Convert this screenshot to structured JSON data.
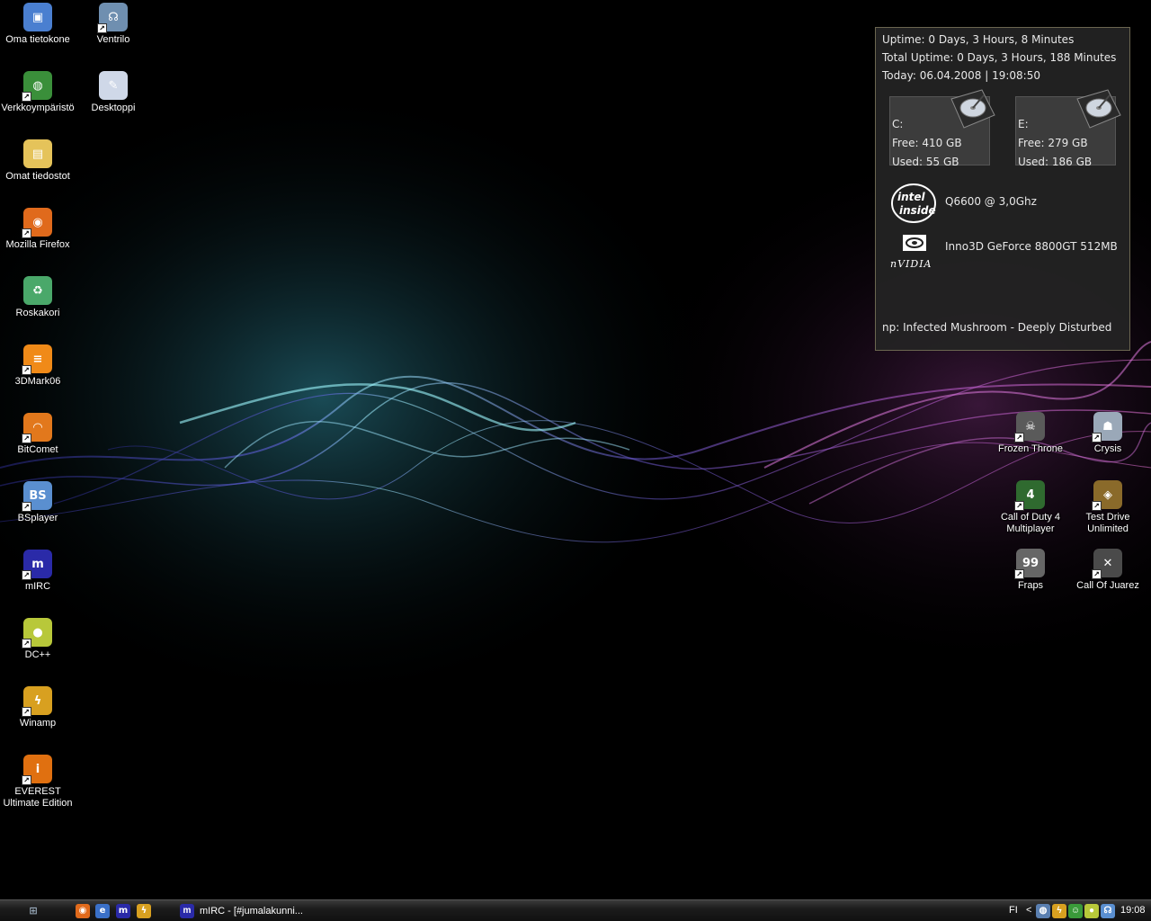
{
  "desktop_left": [
    {
      "label": "Oma tietokone",
      "icon": "my-computer-icon",
      "color": "#4a7fd0",
      "glyph": "▣",
      "shortcut": false
    },
    {
      "label": "Verkkoympäristö",
      "icon": "network-icon",
      "color": "#3a8f3a",
      "glyph": "◍",
      "shortcut": true
    },
    {
      "label": "Omat tiedostot",
      "icon": "my-documents-icon",
      "color": "#e5c35a",
      "glyph": "▤",
      "shortcut": false
    },
    {
      "label": "Mozilla Firefox",
      "icon": "firefox-icon",
      "color": "#e06a1c",
      "glyph": "◉",
      "shortcut": true
    },
    {
      "label": "Roskakori",
      "icon": "recycle-bin-icon",
      "color": "#4aa86a",
      "glyph": "♻",
      "shortcut": false
    },
    {
      "label": "3DMark06",
      "icon": "3dmark-icon",
      "color": "#f08a18",
      "glyph": "≡",
      "shortcut": true
    },
    {
      "label": "BitComet",
      "icon": "bitcomet-icon",
      "color": "#e2781c",
      "glyph": "◠",
      "shortcut": true
    },
    {
      "label": "BSplayer",
      "icon": "bsplayer-icon",
      "color": "#5a8fd0",
      "glyph": "BS",
      "shortcut": true
    },
    {
      "label": "mIRC",
      "icon": "mirc-icon",
      "color": "#2a2aa8",
      "glyph": "m",
      "shortcut": true
    },
    {
      "label": "DC++",
      "icon": "dcpp-icon",
      "color": "#b8c83a",
      "glyph": "●",
      "shortcut": true
    },
    {
      "label": "Winamp",
      "icon": "winamp-icon",
      "color": "#d8a020",
      "glyph": "ϟ",
      "shortcut": true
    },
    {
      "label": "EVEREST Ultimate Edition",
      "icon": "everest-icon",
      "color": "#e07010",
      "glyph": "i",
      "shortcut": true
    }
  ],
  "desktop_col2": [
    {
      "label": "Ventrilo",
      "icon": "ventrilo-icon",
      "color": "#6f8fb0",
      "glyph": "☊",
      "shortcut": true
    },
    {
      "label": "Desktoppi",
      "icon": "desktoppi-icon",
      "color": "#cfd8e8",
      "glyph": "✎",
      "shortcut": false
    }
  ],
  "desktop_right": [
    {
      "label": "Frozen Throne",
      "icon": "frozen-throne-icon",
      "color": "#5a5a5a",
      "glyph": "☠",
      "shortcut": true
    },
    {
      "label": "Crysis",
      "icon": "crysis-icon",
      "color": "#9aa8b8",
      "glyph": "☗",
      "shortcut": true
    },
    {
      "label": "Call of Duty 4 Multiplayer",
      "icon": "cod4-icon",
      "color": "#2f6a2f",
      "glyph": "4",
      "shortcut": true
    },
    {
      "label": "Test Drive Unlimited",
      "icon": "test-drive-icon",
      "color": "#8a6a2a",
      "glyph": "◈",
      "shortcut": true
    },
    {
      "label": "Fraps",
      "icon": "fraps-icon",
      "color": "#666666",
      "glyph": "99",
      "shortcut": true
    },
    {
      "label": "Call Of Juarez",
      "icon": "call-of-juarez-icon",
      "color": "#4a4a4a",
      "glyph": "✕",
      "shortcut": true
    }
  ],
  "widget": {
    "uptime": "Uptime: 0 Days, 3 Hours, 8 Minutes",
    "total_uptime": "Total Uptime: 0 Days, 3 Hours, 188 Minutes",
    "today": "Today: 06.04.2008 | 19:08:50",
    "drives": [
      {
        "name": "C:",
        "free": "Free: 410 GB",
        "used": "Used: 55 GB"
      },
      {
        "name": "E:",
        "free": "Free: 279 GB",
        "used": "Used: 186 GB"
      }
    ],
    "cpu": "Q6600 @ 3,0Ghz",
    "cpu_logo_line1": "intel",
    "cpu_logo_line2": "inside",
    "gpu": "Inno3D GeForce 8800GT 512MB",
    "gpu_logo": "nVIDIA",
    "now_playing": "np: Infected Mushroom - Deeply Disturbed"
  },
  "taskbar": {
    "task_label": "mIRC - [#jumalakunni...",
    "language": "FI",
    "tray_arrow": "<",
    "clock": "19:08"
  }
}
